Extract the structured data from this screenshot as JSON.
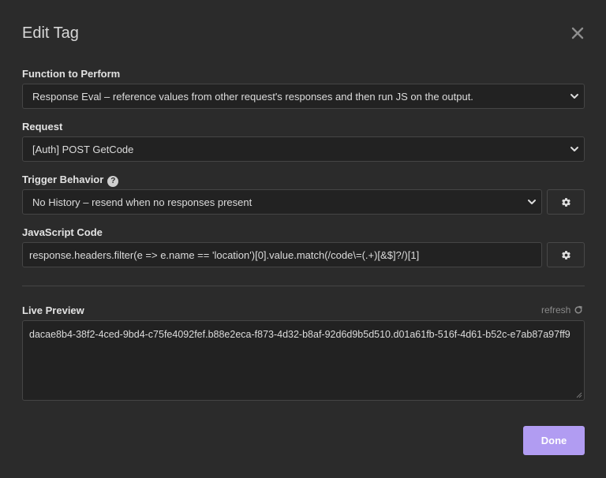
{
  "modal": {
    "title": "Edit Tag"
  },
  "function": {
    "label": "Function to Perform",
    "selected": "Response Eval – reference values from other request's responses and then run JS on the output."
  },
  "request": {
    "label": "Request",
    "selected": "[Auth] POST GetCode"
  },
  "trigger": {
    "label": "Trigger Behavior",
    "help_icon": "?",
    "selected": "No History – resend when no responses present"
  },
  "javascript": {
    "label": "JavaScript Code",
    "value": "response.headers.filter(e => e.name == 'location')[0].value.match(/code\\=(.+)[&$]?/)[1]"
  },
  "preview": {
    "label": "Live Preview",
    "refresh_label": "refresh",
    "value": "dacae8b4-38f2-4ced-9bd4-c75fe4092fef.b88e2eca-f873-4d32-b8af-92d6d9b5d510.d01a61fb-516f-4d61-b52c-e7ab87a97ff9"
  },
  "footer": {
    "done_label": "Done"
  },
  "icons": {
    "close": "close-icon",
    "chevron": "chevron-down-icon",
    "gear": "gear-icon",
    "refresh": "refresh-icon"
  },
  "colors": {
    "background": "#2b2b2b",
    "field_bg": "#222222",
    "border": "#454545",
    "accent": "#b19cf2"
  }
}
